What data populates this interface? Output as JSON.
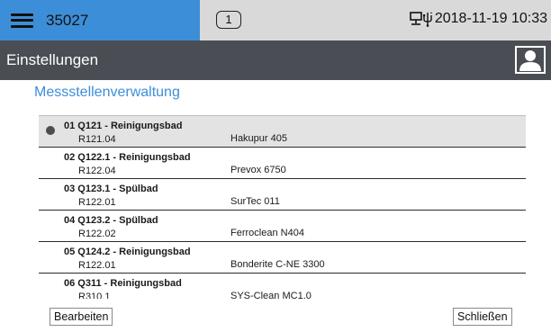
{
  "header": {
    "device_id": "35027",
    "notification_count": "1",
    "datetime": "2018-11-19 10:33"
  },
  "icons": {
    "menu": "hamburger-menu-icon",
    "network": "network-icon",
    "usb": "usb-icon",
    "user": "user-icon"
  },
  "titlebar": {
    "title": "Einstellungen"
  },
  "section": {
    "title": "Messstellenverwaltung"
  },
  "list": {
    "items": [
      {
        "title": "01 Q121 - Reinigungsbad",
        "code": "R121.04",
        "product": "Hakupur 405",
        "selected": true
      },
      {
        "title": "02 Q122.1 - Reinigungsbad",
        "code": "R122.04",
        "product": "Prevox 6750"
      },
      {
        "title": "03 Q123.1 - Spülbad",
        "code": "R122.01",
        "product": "SurTec 011"
      },
      {
        "title": "04 Q123.2 - Spülbad",
        "code": "R122.02",
        "product": "Ferroclean N404"
      },
      {
        "title": "05 Q124.2 - Reinigungsbad",
        "code": "R122.01",
        "product": "Bonderite C-NE 3300"
      },
      {
        "title": "06 Q311 - Reinigungsbad",
        "code": "R310.1",
        "product": "SYS-Clean MC1.0"
      }
    ]
  },
  "footer": {
    "edit_label": "Bearbeiten",
    "close_label": "Schließen"
  },
  "colors": {
    "accent": "#3d8ed8",
    "titlebar": "#4a4e54",
    "header_gray": "#d9d9d9",
    "selected_row": "#e3e3e3"
  }
}
